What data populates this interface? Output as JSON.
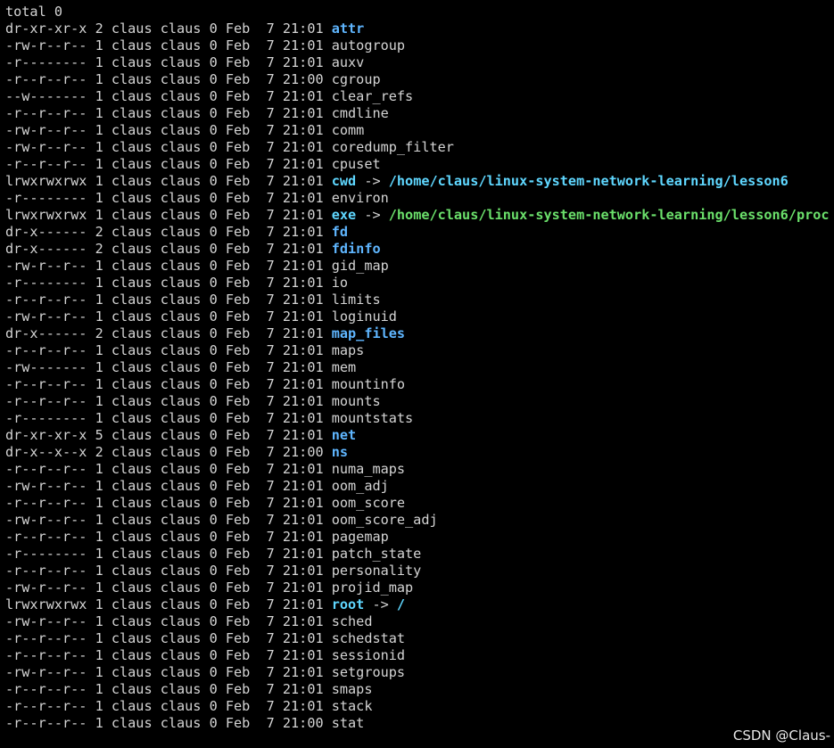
{
  "header": "total 0",
  "entries": [
    {
      "perm": "dr-xr-xr-x",
      "links": "2",
      "user": "claus",
      "group": "claus",
      "size": "0",
      "month": "Feb",
      "day": "7",
      "time": "21:01",
      "name": "attr",
      "kind": "dir"
    },
    {
      "perm": "-rw-r--r--",
      "links": "1",
      "user": "claus",
      "group": "claus",
      "size": "0",
      "month": "Feb",
      "day": "7",
      "time": "21:01",
      "name": "autogroup",
      "kind": "file"
    },
    {
      "perm": "-r--------",
      "links": "1",
      "user": "claus",
      "group": "claus",
      "size": "0",
      "month": "Feb",
      "day": "7",
      "time": "21:01",
      "name": "auxv",
      "kind": "file"
    },
    {
      "perm": "-r--r--r--",
      "links": "1",
      "user": "claus",
      "group": "claus",
      "size": "0",
      "month": "Feb",
      "day": "7",
      "time": "21:00",
      "name": "cgroup",
      "kind": "file"
    },
    {
      "perm": "--w-------",
      "links": "1",
      "user": "claus",
      "group": "claus",
      "size": "0",
      "month": "Feb",
      "day": "7",
      "time": "21:01",
      "name": "clear_refs",
      "kind": "file"
    },
    {
      "perm": "-r--r--r--",
      "links": "1",
      "user": "claus",
      "group": "claus",
      "size": "0",
      "month": "Feb",
      "day": "7",
      "time": "21:01",
      "name": "cmdline",
      "kind": "file"
    },
    {
      "perm": "-rw-r--r--",
      "links": "1",
      "user": "claus",
      "group": "claus",
      "size": "0",
      "month": "Feb",
      "day": "7",
      "time": "21:01",
      "name": "comm",
      "kind": "file"
    },
    {
      "perm": "-rw-r--r--",
      "links": "1",
      "user": "claus",
      "group": "claus",
      "size": "0",
      "month": "Feb",
      "day": "7",
      "time": "21:01",
      "name": "coredump_filter",
      "kind": "file"
    },
    {
      "perm": "-r--r--r--",
      "links": "1",
      "user": "claus",
      "group": "claus",
      "size": "0",
      "month": "Feb",
      "day": "7",
      "time": "21:01",
      "name": "cpuset",
      "kind": "file"
    },
    {
      "perm": "lrwxrwxrwx",
      "links": "1",
      "user": "claus",
      "group": "claus",
      "size": "0",
      "month": "Feb",
      "day": "7",
      "time": "21:01",
      "name": "cwd",
      "kind": "link",
      "target": "/home/claus/linux-system-network-learning/lesson6",
      "target_kind": "dir"
    },
    {
      "perm": "-r--------",
      "links": "1",
      "user": "claus",
      "group": "claus",
      "size": "0",
      "month": "Feb",
      "day": "7",
      "time": "21:01",
      "name": "environ",
      "kind": "file"
    },
    {
      "perm": "lrwxrwxrwx",
      "links": "1",
      "user": "claus",
      "group": "claus",
      "size": "0",
      "month": "Feb",
      "day": "7",
      "time": "21:01",
      "name": "exe",
      "kind": "link",
      "target": "/home/claus/linux-system-network-learning/lesson6/proc",
      "target_kind": "exec"
    },
    {
      "perm": "dr-x------",
      "links": "2",
      "user": "claus",
      "group": "claus",
      "size": "0",
      "month": "Feb",
      "day": "7",
      "time": "21:01",
      "name": "fd",
      "kind": "dir"
    },
    {
      "perm": "dr-x------",
      "links": "2",
      "user": "claus",
      "group": "claus",
      "size": "0",
      "month": "Feb",
      "day": "7",
      "time": "21:01",
      "name": "fdinfo",
      "kind": "dir"
    },
    {
      "perm": "-rw-r--r--",
      "links": "1",
      "user": "claus",
      "group": "claus",
      "size": "0",
      "month": "Feb",
      "day": "7",
      "time": "21:01",
      "name": "gid_map",
      "kind": "file"
    },
    {
      "perm": "-r--------",
      "links": "1",
      "user": "claus",
      "group": "claus",
      "size": "0",
      "month": "Feb",
      "day": "7",
      "time": "21:01",
      "name": "io",
      "kind": "file"
    },
    {
      "perm": "-r--r--r--",
      "links": "1",
      "user": "claus",
      "group": "claus",
      "size": "0",
      "month": "Feb",
      "day": "7",
      "time": "21:01",
      "name": "limits",
      "kind": "file"
    },
    {
      "perm": "-rw-r--r--",
      "links": "1",
      "user": "claus",
      "group": "claus",
      "size": "0",
      "month": "Feb",
      "day": "7",
      "time": "21:01",
      "name": "loginuid",
      "kind": "file"
    },
    {
      "perm": "dr-x------",
      "links": "2",
      "user": "claus",
      "group": "claus",
      "size": "0",
      "month": "Feb",
      "day": "7",
      "time": "21:01",
      "name": "map_files",
      "kind": "dir"
    },
    {
      "perm": "-r--r--r--",
      "links": "1",
      "user": "claus",
      "group": "claus",
      "size": "0",
      "month": "Feb",
      "day": "7",
      "time": "21:01",
      "name": "maps",
      "kind": "file"
    },
    {
      "perm": "-rw-------",
      "links": "1",
      "user": "claus",
      "group": "claus",
      "size": "0",
      "month": "Feb",
      "day": "7",
      "time": "21:01",
      "name": "mem",
      "kind": "file"
    },
    {
      "perm": "-r--r--r--",
      "links": "1",
      "user": "claus",
      "group": "claus",
      "size": "0",
      "month": "Feb",
      "day": "7",
      "time": "21:01",
      "name": "mountinfo",
      "kind": "file"
    },
    {
      "perm": "-r--r--r--",
      "links": "1",
      "user": "claus",
      "group": "claus",
      "size": "0",
      "month": "Feb",
      "day": "7",
      "time": "21:01",
      "name": "mounts",
      "kind": "file"
    },
    {
      "perm": "-r--------",
      "links": "1",
      "user": "claus",
      "group": "claus",
      "size": "0",
      "month": "Feb",
      "day": "7",
      "time": "21:01",
      "name": "mountstats",
      "kind": "file"
    },
    {
      "perm": "dr-xr-xr-x",
      "links": "5",
      "user": "claus",
      "group": "claus",
      "size": "0",
      "month": "Feb",
      "day": "7",
      "time": "21:01",
      "name": "net",
      "kind": "dir"
    },
    {
      "perm": "dr-x--x--x",
      "links": "2",
      "user": "claus",
      "group": "claus",
      "size": "0",
      "month": "Feb",
      "day": "7",
      "time": "21:00",
      "name": "ns",
      "kind": "dir"
    },
    {
      "perm": "-r--r--r--",
      "links": "1",
      "user": "claus",
      "group": "claus",
      "size": "0",
      "month": "Feb",
      "day": "7",
      "time": "21:01",
      "name": "numa_maps",
      "kind": "file"
    },
    {
      "perm": "-rw-r--r--",
      "links": "1",
      "user": "claus",
      "group": "claus",
      "size": "0",
      "month": "Feb",
      "day": "7",
      "time": "21:01",
      "name": "oom_adj",
      "kind": "file"
    },
    {
      "perm": "-r--r--r--",
      "links": "1",
      "user": "claus",
      "group": "claus",
      "size": "0",
      "month": "Feb",
      "day": "7",
      "time": "21:01",
      "name": "oom_score",
      "kind": "file"
    },
    {
      "perm": "-rw-r--r--",
      "links": "1",
      "user": "claus",
      "group": "claus",
      "size": "0",
      "month": "Feb",
      "day": "7",
      "time": "21:01",
      "name": "oom_score_adj",
      "kind": "file"
    },
    {
      "perm": "-r--r--r--",
      "links": "1",
      "user": "claus",
      "group": "claus",
      "size": "0",
      "month": "Feb",
      "day": "7",
      "time": "21:01",
      "name": "pagemap",
      "kind": "file"
    },
    {
      "perm": "-r--------",
      "links": "1",
      "user": "claus",
      "group": "claus",
      "size": "0",
      "month": "Feb",
      "day": "7",
      "time": "21:01",
      "name": "patch_state",
      "kind": "file"
    },
    {
      "perm": "-r--r--r--",
      "links": "1",
      "user": "claus",
      "group": "claus",
      "size": "0",
      "month": "Feb",
      "day": "7",
      "time": "21:01",
      "name": "personality",
      "kind": "file"
    },
    {
      "perm": "-rw-r--r--",
      "links": "1",
      "user": "claus",
      "group": "claus",
      "size": "0",
      "month": "Feb",
      "day": "7",
      "time": "21:01",
      "name": "projid_map",
      "kind": "file"
    },
    {
      "perm": "lrwxrwxrwx",
      "links": "1",
      "user": "claus",
      "group": "claus",
      "size": "0",
      "month": "Feb",
      "day": "7",
      "time": "21:01",
      "name": "root",
      "kind": "link",
      "target": "/",
      "target_kind": "dir"
    },
    {
      "perm": "-rw-r--r--",
      "links": "1",
      "user": "claus",
      "group": "claus",
      "size": "0",
      "month": "Feb",
      "day": "7",
      "time": "21:01",
      "name": "sched",
      "kind": "file"
    },
    {
      "perm": "-r--r--r--",
      "links": "1",
      "user": "claus",
      "group": "claus",
      "size": "0",
      "month": "Feb",
      "day": "7",
      "time": "21:01",
      "name": "schedstat",
      "kind": "file"
    },
    {
      "perm": "-r--r--r--",
      "links": "1",
      "user": "claus",
      "group": "claus",
      "size": "0",
      "month": "Feb",
      "day": "7",
      "time": "21:01",
      "name": "sessionid",
      "kind": "file"
    },
    {
      "perm": "-rw-r--r--",
      "links": "1",
      "user": "claus",
      "group": "claus",
      "size": "0",
      "month": "Feb",
      "day": "7",
      "time": "21:01",
      "name": "setgroups",
      "kind": "file"
    },
    {
      "perm": "-r--r--r--",
      "links": "1",
      "user": "claus",
      "group": "claus",
      "size": "0",
      "month": "Feb",
      "day": "7",
      "time": "21:01",
      "name": "smaps",
      "kind": "file"
    },
    {
      "perm": "-r--r--r--",
      "links": "1",
      "user": "claus",
      "group": "claus",
      "size": "0",
      "month": "Feb",
      "day": "7",
      "time": "21:01",
      "name": "stack",
      "kind": "file"
    },
    {
      "perm": "-r--r--r--",
      "links": "1",
      "user": "claus",
      "group": "claus",
      "size": "0",
      "month": "Feb",
      "day": "7",
      "time": "21:00",
      "name": "stat",
      "kind": "file"
    }
  ],
  "link_arrow": "->",
  "watermark": "CSDN @Claus-",
  "colors": {
    "background": "#000000",
    "text": "#d4d4d4",
    "directory": "#5fb6ff",
    "symlink": "#5fd7ff",
    "executable": "#6be06b"
  }
}
